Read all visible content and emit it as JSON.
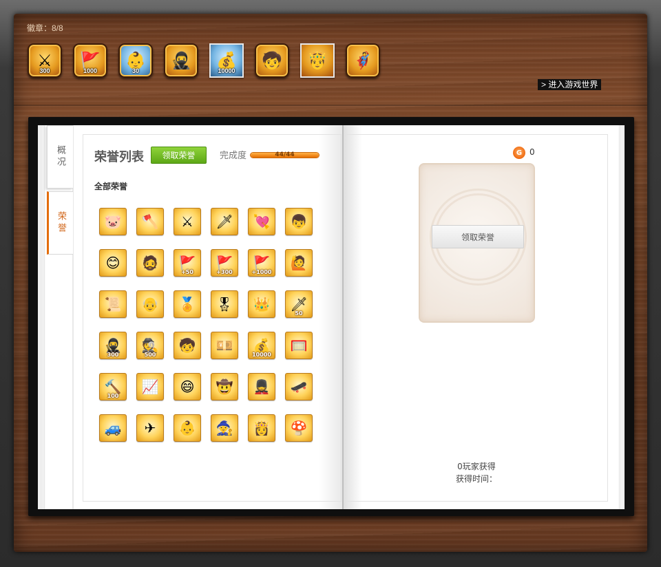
{
  "header": {
    "badge_count_label": "徽章：8/8",
    "enter_world": "> 进入游戏世界",
    "badges": [
      {
        "icon": "sword-badge-icon",
        "glyph": "⚔",
        "num": "300",
        "style": "gold"
      },
      {
        "icon": "flag-badge-icon",
        "glyph": "🚩",
        "num": "1000",
        "style": "gold"
      },
      {
        "icon": "character-badge-icon",
        "glyph": "👶",
        "num": "30",
        "style": "blue"
      },
      {
        "icon": "ninja-badge-icon",
        "glyph": "🥷",
        "num": "",
        "style": "gold"
      },
      {
        "icon": "coins-badge-icon",
        "glyph": "💰",
        "num": "10000",
        "style": "blue-square"
      },
      {
        "icon": "hero-badge-icon",
        "glyph": "🧒",
        "num": "",
        "style": "gold"
      },
      {
        "icon": "king-badge-icon",
        "glyph": "🤴",
        "num": "",
        "style": "gold-square"
      },
      {
        "icon": "flying-badge-icon",
        "glyph": "🦸",
        "num": "",
        "style": "gold"
      }
    ]
  },
  "tabs": {
    "overview": "概况",
    "honor": "荣誉"
  },
  "left": {
    "title": "荣誉列表",
    "claim_button": "领取荣誉",
    "completion_label": "完成度",
    "progress_text": "44/44",
    "progress_fraction": 1.0,
    "section_label": "全部荣誉",
    "honors": [
      {
        "icon": "pig-honor-icon",
        "glyph": "🐷",
        "num": ""
      },
      {
        "icon": "flag-axe-honor-icon",
        "glyph": "🪓",
        "num": ""
      },
      {
        "icon": "flag-sword-honor-icon",
        "glyph": "⚔",
        "num": ""
      },
      {
        "icon": "red-flag-sword-honor-icon",
        "glyph": "🗡",
        "num": ""
      },
      {
        "icon": "cupid-honor-icon",
        "glyph": "💘",
        "num": ""
      },
      {
        "icon": "kid-honor-icon",
        "glyph": "👦",
        "num": ""
      },
      {
        "icon": "face-honor-icon",
        "glyph": "😊",
        "num": ""
      },
      {
        "icon": "boss-honor-icon",
        "glyph": "🧔",
        "num": ""
      },
      {
        "icon": "flag-50-honor-icon",
        "glyph": "🚩",
        "num": "+50"
      },
      {
        "icon": "flag-300-honor-icon",
        "glyph": "🚩",
        "num": "+300"
      },
      {
        "icon": "flag-1000-honor-icon",
        "glyph": "🚩",
        "num": "+1000"
      },
      {
        "icon": "kid-flag-honor-icon",
        "glyph": "🙋",
        "num": ""
      },
      {
        "icon": "scroll-honor-icon",
        "glyph": "📜",
        "num": ""
      },
      {
        "icon": "uncle-honor-icon",
        "glyph": "👴",
        "num": ""
      },
      {
        "icon": "gold-medal-honor-icon",
        "glyph": "🏅",
        "num": ""
      },
      {
        "icon": "wing-medal-honor-icon",
        "glyph": "🎖",
        "num": ""
      },
      {
        "icon": "crown-medal-honor-icon",
        "glyph": "👑",
        "num": ""
      },
      {
        "icon": "sword-50-honor-icon",
        "glyph": "🗡",
        "num": "50"
      },
      {
        "icon": "ninja-300-honor-icon",
        "glyph": "🥷",
        "num": "300"
      },
      {
        "icon": "spy-500-honor-icon",
        "glyph": "🕵",
        "num": "500"
      },
      {
        "icon": "blue-kid-honor-icon",
        "glyph": "🧒",
        "num": ""
      },
      {
        "icon": "money-honor-icon",
        "glyph": "💴",
        "num": ""
      },
      {
        "icon": "coins-10000-honor-icon",
        "glyph": "💰",
        "num": "10000"
      },
      {
        "icon": "cage-honor-icon",
        "glyph": "🥅",
        "num": ""
      },
      {
        "icon": "mace-100-honor-icon",
        "glyph": "🔨",
        "num": "100"
      },
      {
        "icon": "chart-honor-icon",
        "glyph": "📈",
        "num": ""
      },
      {
        "icon": "smile-kid-honor-icon",
        "glyph": "😄",
        "num": ""
      },
      {
        "icon": "cowboy-honor-icon",
        "glyph": "🤠",
        "num": ""
      },
      {
        "icon": "soldier-honor-icon",
        "glyph": "💂",
        "num": ""
      },
      {
        "icon": "skate-kid-honor-icon",
        "glyph": "🛹",
        "num": ""
      },
      {
        "icon": "car-honor-icon",
        "glyph": "🚙",
        "num": ""
      },
      {
        "icon": "plane-honor-icon",
        "glyph": "✈",
        "num": ""
      },
      {
        "icon": "baby-honor-icon",
        "glyph": "👶",
        "num": ""
      },
      {
        "icon": "monk-honor-icon",
        "glyph": "🧙",
        "num": ""
      },
      {
        "icon": "princess-honor-icon",
        "glyph": "👸",
        "num": ""
      },
      {
        "icon": "mushroom-honor-icon",
        "glyph": "🍄",
        "num": ""
      }
    ]
  },
  "right": {
    "coin_count": "0",
    "card_button": "领取荣誉",
    "obtained_players": "0玩家获得",
    "obtained_time": "获得时间："
  }
}
